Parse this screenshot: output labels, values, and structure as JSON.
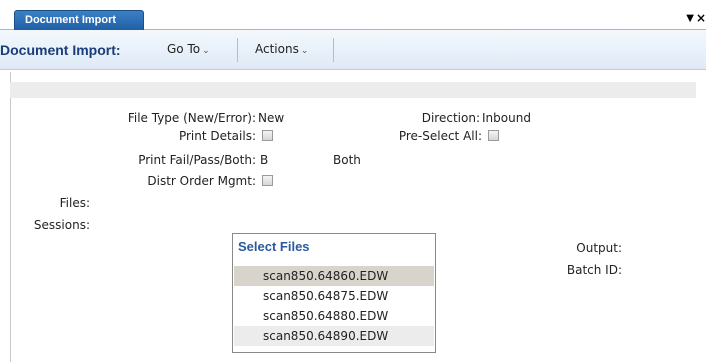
{
  "tab": {
    "label": "Document Import"
  },
  "toolbar": {
    "title": "Document Import:",
    "menus": [
      {
        "label": "Go To"
      },
      {
        "label": "Actions"
      }
    ]
  },
  "form": {
    "file_type": {
      "label": "File Type (New/Error):",
      "value": "New"
    },
    "direction": {
      "label": "Direction:",
      "value": "Inbound"
    },
    "print_details": {
      "label": "Print Details:",
      "checked": false
    },
    "pre_select_all": {
      "label": "Pre-Select All:",
      "checked": false
    },
    "print_fail_pass_both": {
      "label": "Print Fail/Pass/Both:",
      "code": "B",
      "description": "Both"
    },
    "distr_order_mgmt": {
      "label": "Distr Order Mgmt:",
      "checked": false
    },
    "files": {
      "label": "Files:"
    },
    "sessions": {
      "label": "Sessions:"
    },
    "output": {
      "label": "Output:"
    },
    "batch_id": {
      "label": "Batch ID:"
    }
  },
  "select_files": {
    "title": "Select Files",
    "items": [
      {
        "name": "scan850.64860.EDW",
        "selected": true
      },
      {
        "name": "scan850.64875.EDW",
        "selected": false
      },
      {
        "name": "scan850.64880.EDW",
        "selected": false
      },
      {
        "name": "scan850.64890.EDW",
        "selected": false
      }
    ]
  }
}
